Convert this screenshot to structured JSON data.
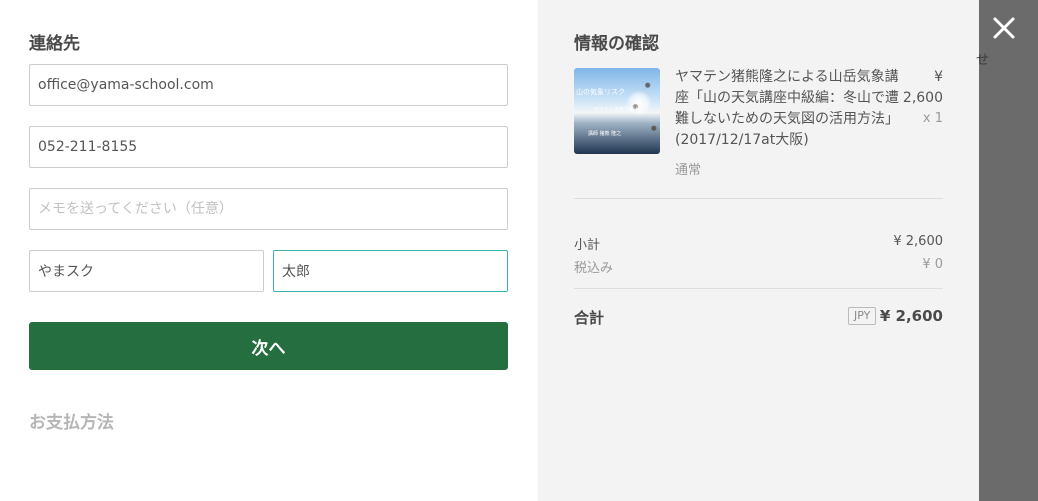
{
  "contact": {
    "heading": "連絡先",
    "email_value": "office@yama-school.com",
    "phone_value": "052-211-8155",
    "memo_placeholder": "メモを送ってください（任意）",
    "last_name_value": "やまスク",
    "first_name_value": "太郎",
    "next_label": "次へ",
    "payment_heading": "お支払方法"
  },
  "summary": {
    "heading": "情報の確認",
    "product": {
      "thumbnail_icon": "product-thumbnail-image",
      "thumbnail_text": "山の気象リスク",
      "thumbnail_subtext1": "ヤマテン天気予報士",
      "thumbnail_subtext2": "講師 猪熊 隆之",
      "title": "ヤマテン猪熊隆之による山岳気象講座「山の天気講座中級編：冬山で遭難しないための天気図の活用方法」(2017/12/17at大阪)",
      "price": "¥ 2,600",
      "quantity": "x 1",
      "variant": "通常"
    },
    "subtotal_label": "小計",
    "subtotal_value": "¥ 2,600",
    "tax_label": "税込み",
    "tax_value": "¥ 0",
    "total_label": "合計",
    "currency": "JPY",
    "total_value": "¥ 2,600"
  },
  "overlay": {
    "close_icon": "close-icon",
    "background_glyph": "せ"
  },
  "colors": {
    "primary_button": "#246e40",
    "focus_border": "#3ab0b0",
    "summary_background": "#f3f3f3",
    "overlay_background": "#6b6b6b"
  }
}
